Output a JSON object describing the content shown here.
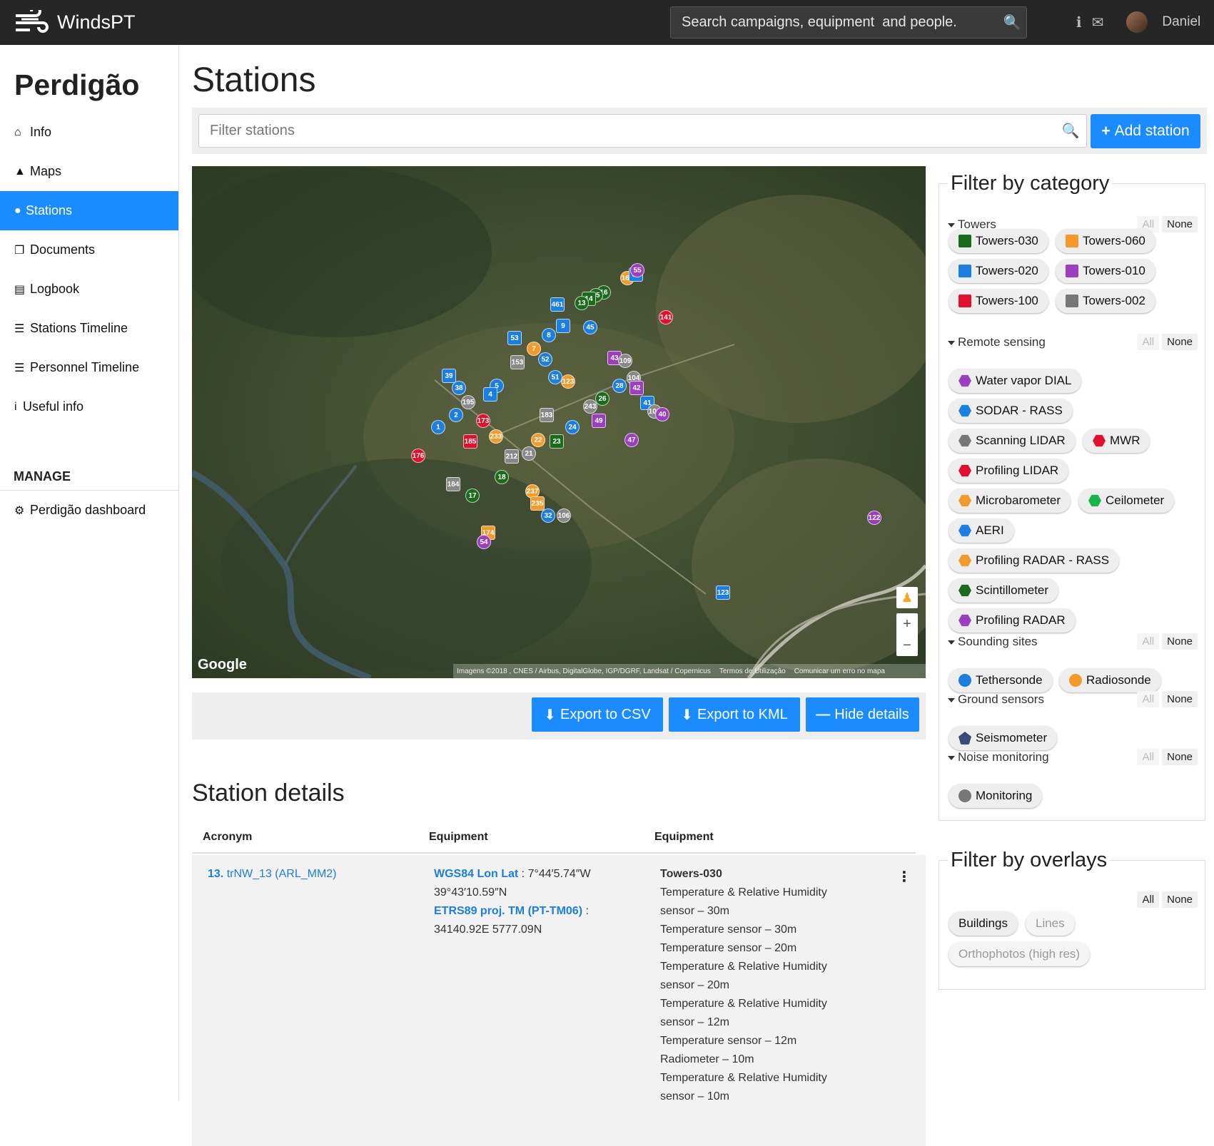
{
  "app": {
    "brand": "WindsPT",
    "search_placeholder": "Search campaigns, equipment  and people.",
    "user": "Daniel"
  },
  "sidebar": {
    "project": "Perdigão",
    "items": [
      {
        "icon": "home-icon",
        "label": "Info"
      },
      {
        "icon": "area-chart-icon",
        "label": "Maps"
      },
      {
        "icon": "map-marker-icon",
        "label": "Stations"
      },
      {
        "icon": "documents-icon",
        "label": "Documents"
      },
      {
        "icon": "newspaper-icon",
        "label": "Logbook"
      },
      {
        "icon": "list-icon",
        "label": "Stations Timeline"
      },
      {
        "icon": "list-icon",
        "label": "Personnel Timeline"
      },
      {
        "icon": "info-icon",
        "label": "Useful info"
      }
    ],
    "manage_title": "MANAGE",
    "manage_items": [
      {
        "icon": "gear-icon",
        "label": "Perdigão dashboard"
      }
    ]
  },
  "main": {
    "title": "Stations",
    "filter_placeholder": "Filter stations",
    "add_label": "Add station"
  },
  "map": {
    "google": "Google",
    "attribution": "Imagens ©2018 , CNES / Airbus, DigitalGlobe, IGP/DGRF, Landsat / Copernicus",
    "terms": "Termos de Utilização",
    "report": "Comunicar um erro no mapa",
    "markers": [
      {
        "n": "461",
        "c": "#1a7fe0"
      },
      {
        "n": "16",
        "c": "#1a6b1a"
      },
      {
        "n": "15",
        "c": "#1a6b1a"
      },
      {
        "n": "14",
        "c": "#1a6b1a"
      },
      {
        "n": "13",
        "c": "#1a6b1a"
      },
      {
        "n": "162",
        "c": "#f29b2a"
      },
      {
        "n": "54",
        "c": "#1a7fe0"
      },
      {
        "n": "55",
        "c": "#9b3fc0"
      },
      {
        "n": "141",
        "c": "#e0102e"
      },
      {
        "n": "9",
        "c": "#1a7fe0"
      },
      {
        "n": "45",
        "c": "#1a7fe0"
      },
      {
        "n": "8",
        "c": "#1a7fe0"
      },
      {
        "n": "53",
        "c": "#1a7fe0"
      },
      {
        "n": "7",
        "c": "#f29b2a"
      },
      {
        "n": "52",
        "c": "#1a7fe0"
      },
      {
        "n": "153",
        "c": "#888888"
      },
      {
        "n": "51",
        "c": "#1a7fe0"
      },
      {
        "n": "123",
        "c": "#f29b2a"
      },
      {
        "n": "43",
        "c": "#9b3fc0"
      },
      {
        "n": "109",
        "c": "#888888"
      },
      {
        "n": "104",
        "c": "#888888"
      },
      {
        "n": "39",
        "c": "#1a7fe0"
      },
      {
        "n": "38",
        "c": "#1a7fe0"
      },
      {
        "n": "5",
        "c": "#1a7fe0"
      },
      {
        "n": "4",
        "c": "#1a7fe0"
      },
      {
        "n": "195",
        "c": "#888888"
      },
      {
        "n": "28",
        "c": "#1a7fe0"
      },
      {
        "n": "42",
        "c": "#9b3fc0"
      },
      {
        "n": "26",
        "c": "#1a6b1a"
      },
      {
        "n": "243",
        "c": "#888888"
      },
      {
        "n": "41",
        "c": "#1a7fe0"
      },
      {
        "n": "108",
        "c": "#888888"
      },
      {
        "n": "40",
        "c": "#9b3fc0"
      },
      {
        "n": "183",
        "c": "#888888"
      },
      {
        "n": "2",
        "c": "#1a7fe0"
      },
      {
        "n": "1",
        "c": "#1a7fe0"
      },
      {
        "n": "49",
        "c": "#9b3fc0"
      },
      {
        "n": "24",
        "c": "#1a7fe0"
      },
      {
        "n": "173",
        "c": "#e0102e"
      },
      {
        "n": "185",
        "c": "#e0102e"
      },
      {
        "n": "233",
        "c": "#f29b2a"
      },
      {
        "n": "22",
        "c": "#f29b2a"
      },
      {
        "n": "23",
        "c": "#1a6b1a"
      },
      {
        "n": "47",
        "c": "#9b3fc0"
      },
      {
        "n": "21",
        "c": "#888888"
      },
      {
        "n": "212",
        "c": "#888888"
      },
      {
        "n": "176",
        "c": "#e0102e"
      },
      {
        "n": "18",
        "c": "#1a6b1a"
      },
      {
        "n": "184",
        "c": "#888888"
      },
      {
        "n": "17",
        "c": "#1a6b1a"
      },
      {
        "n": "237",
        "c": "#f29b2a"
      },
      {
        "n": "235",
        "c": "#f29b2a"
      },
      {
        "n": "32",
        "c": "#1a7fe0"
      },
      {
        "n": "106",
        "c": "#888888"
      },
      {
        "n": "174",
        "c": "#f29b2a"
      },
      {
        "n": "54",
        "c": "#9b3fc0"
      },
      {
        "n": "122",
        "c": "#9b3fc0"
      },
      {
        "n": "123",
        "c": "#1a7fe0"
      }
    ]
  },
  "export": {
    "csv": "Export to CSV",
    "kml": "Export to KML",
    "hide": "Hide details"
  },
  "details": {
    "title": "Station details",
    "columns": [
      "Acronym",
      "Equipment",
      "Equipment"
    ],
    "row": {
      "num": "13.",
      "acronym": "trNW_13 (ARL_MM2)",
      "wgs_label": "WGS84 Lon Lat",
      "wgs_value": " : 7°44′5.74″W 39°43′10.59″N",
      "etrs_label": "ETRS89 proj. TM (PT-TM06)",
      "etrs_value": " : 34140.92E 5777.09N",
      "eq_title": "Towers-030",
      "equipment": [
        "Temperature & Relative Humidity sensor – 30m",
        "Temperature sensor – 30m",
        "Temperature sensor – 20m",
        "Temperature & Relative Humidity sensor – 20m",
        "Temperature & Relative Humidity sensor – 12m",
        "Temperature sensor – 12m",
        "Radiometer – 10m",
        "Temperature & Relative Humidity sensor – 10m"
      ]
    }
  },
  "filter_category": {
    "title": "Filter by category",
    "all": "All",
    "none": "None",
    "groups": [
      {
        "name": "Towers",
        "chips": [
          {
            "label": "Towers-030",
            "color": "#1a6b1a"
          },
          {
            "label": "Towers-060",
            "color": "#f29b2a"
          },
          {
            "label": "Towers-020",
            "color": "#1a7fe0"
          },
          {
            "label": "Towers-010",
            "color": "#9b3fc0"
          },
          {
            "label": "Towers-100",
            "color": "#e0102e"
          },
          {
            "label": "Towers-002",
            "color": "#777777"
          }
        ]
      },
      {
        "name": "Remote sensing",
        "chips": [
          {
            "label": "Water vapor DIAL",
            "color": "#9b3fc0"
          },
          {
            "label": "SODAR - RASS",
            "color": "#1a7fe0"
          },
          {
            "label": "Scanning LIDAR",
            "color": "#777777"
          },
          {
            "label": "MWR",
            "color": "#e0102e"
          },
          {
            "label": "Profiling LIDAR",
            "color": "#e0102e"
          },
          {
            "label": "Microbarometer",
            "color": "#f29b2a"
          },
          {
            "label": "Ceilometer",
            "color": "#1ab34a"
          },
          {
            "label": "AERI",
            "color": "#1a7fe0"
          },
          {
            "label": "Profiling RADAR - RASS",
            "color": "#f29b2a"
          },
          {
            "label": "Scintillometer",
            "color": "#1a6b1a"
          },
          {
            "label": "Profiling RADAR",
            "color": "#9b3fc0"
          }
        ]
      },
      {
        "name": "Sounding sites",
        "chips": [
          {
            "label": "Tethersonde",
            "color": "#1a7fe0"
          },
          {
            "label": "Radiosonde",
            "color": "#f29b2a"
          }
        ]
      },
      {
        "name": "Ground sensors",
        "chips": [
          {
            "label": "Seismometer",
            "color": "#3a4a7a"
          }
        ]
      },
      {
        "name": "Noise monitoring",
        "chips": [
          {
            "label": "Monitoring",
            "color": "#777777"
          }
        ]
      }
    ]
  },
  "filter_overlays": {
    "title": "Filter by overlays",
    "all": "All",
    "none": "None",
    "chips": [
      "Buildings",
      "Lines",
      "Orthophotos (high res)"
    ]
  }
}
